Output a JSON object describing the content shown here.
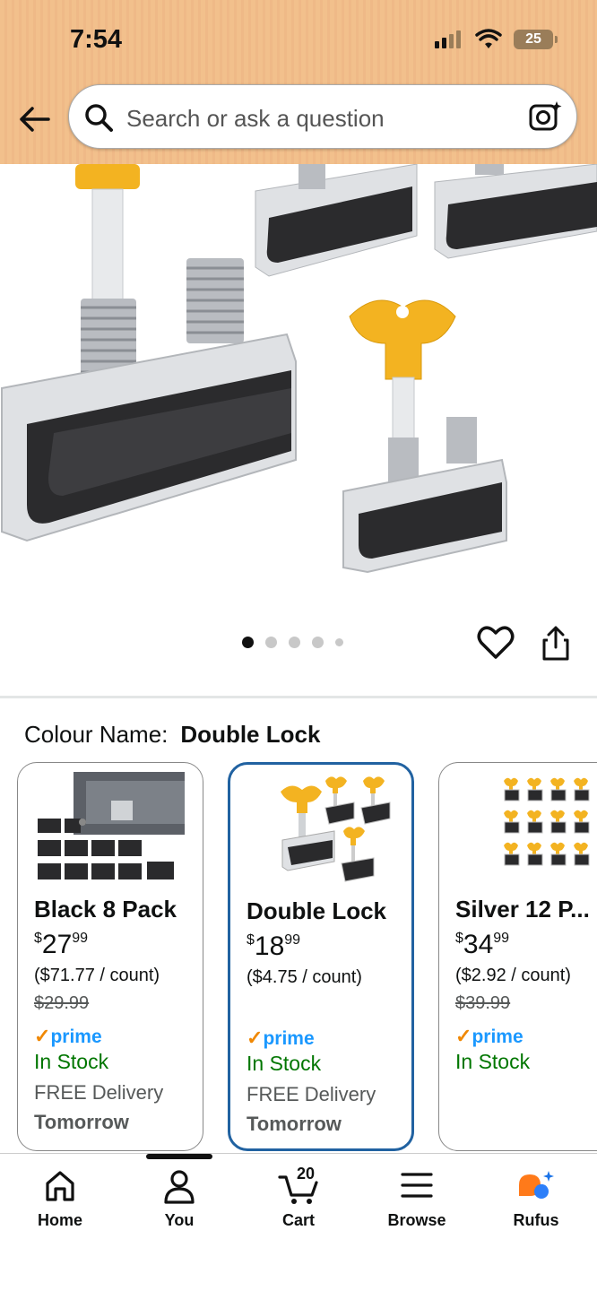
{
  "status_bar": {
    "time": "7:54",
    "battery": "25"
  },
  "search": {
    "placeholder": "Search or ask a question"
  },
  "gallery": {
    "dot_count": 5,
    "active_index": 0
  },
  "variation": {
    "label": "Colour Name:",
    "selected": "Double Lock",
    "cards": [
      {
        "name": "Black 8 Pack",
        "price_whole": "27",
        "price_fraction": "99",
        "currency": "$",
        "unit_price": "($71.77 / count)",
        "was_price": "$29.99",
        "prime": "prime",
        "stock": "In Stock",
        "delivery": "FREE Delivery",
        "delivery_day": "Tomorrow",
        "selected": false
      },
      {
        "name": "Double Lock",
        "price_whole": "18",
        "price_fraction": "99",
        "currency": "$",
        "unit_price": "($4.75 / count)",
        "was_price": "",
        "prime": "prime",
        "stock": "In Stock",
        "delivery": "FREE Delivery",
        "delivery_day": "Tomorrow",
        "selected": true
      },
      {
        "name": "Silver 12 P...",
        "price_whole": "34",
        "price_fraction": "99",
        "currency": "$",
        "unit_price": "($2.92 / count)",
        "was_price": "$39.99",
        "prime": "prime",
        "stock": "In Stock",
        "delivery": "",
        "delivery_day": "",
        "selected": false
      }
    ]
  },
  "bottom_nav": {
    "items": [
      {
        "label": "Home",
        "icon": "home-icon"
      },
      {
        "label": "You",
        "icon": "person-icon"
      },
      {
        "label": "Cart",
        "icon": "cart-icon",
        "count": "20"
      },
      {
        "label": "Browse",
        "icon": "menu-icon"
      },
      {
        "label": "Rufus",
        "icon": "rufus-icon"
      }
    ],
    "active_index": 1
  },
  "colors": {
    "selected_border": "#2162a1",
    "in_stock": "#007600",
    "prime_blue": "#1a98ff",
    "prime_check": "#f08804",
    "header_bg": "#f2c08c"
  }
}
